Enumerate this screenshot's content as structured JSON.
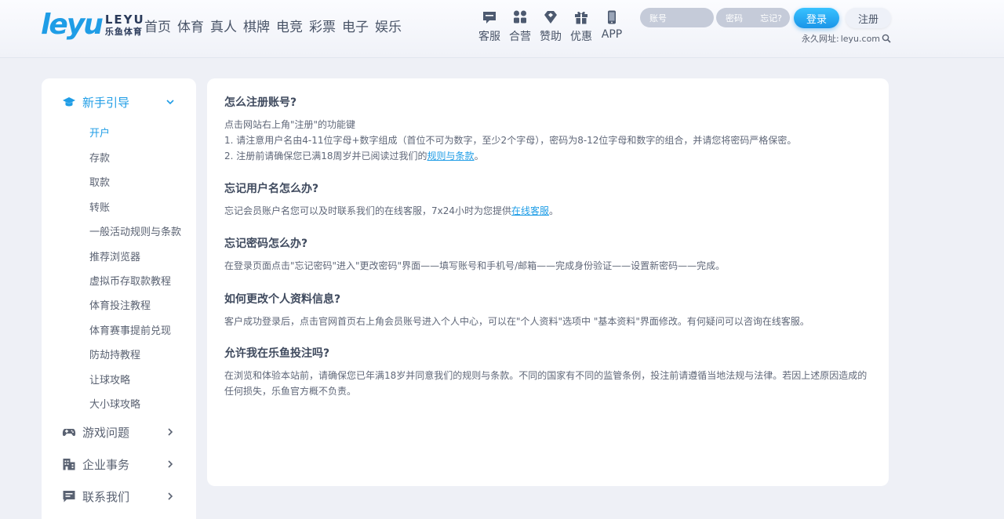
{
  "brand": {
    "logo_text": "leyu",
    "logo_en": "LEYU",
    "logo_cn": "乐鱼体育",
    "accent": "#1f9de6"
  },
  "nav": {
    "items": [
      "首页",
      "体育",
      "真人",
      "棋牌",
      "电竞",
      "彩票",
      "电子",
      "娱乐"
    ]
  },
  "tools": [
    {
      "label": "客服",
      "icon": "chat-icon"
    },
    {
      "label": "合营",
      "icon": "grid-icon"
    },
    {
      "label": "赞助",
      "icon": "diamond-icon"
    },
    {
      "label": "优惠",
      "icon": "gift-icon"
    },
    {
      "label": "APP",
      "icon": "phone-icon"
    }
  ],
  "auth": {
    "username_placeholder": "账号",
    "password_placeholder": "密码",
    "forgot_label": "忘记?",
    "login_label": "登录",
    "register_label": "注册",
    "permanent_label": "永久网址:",
    "permanent_url": "leyu.com"
  },
  "sidebar": {
    "categories": [
      {
        "label": "新手引导",
        "icon": "graduation-cap-icon",
        "expanded": true
      },
      {
        "label": "游戏问题",
        "icon": "gamepad-icon",
        "expanded": false
      },
      {
        "label": "企业事务",
        "icon": "building-icon",
        "expanded": false
      },
      {
        "label": "联系我们",
        "icon": "message-icon",
        "expanded": false
      }
    ],
    "guide_items": [
      "开户",
      "存款",
      "取款",
      "转账",
      "一般活动规则与条款",
      "推荐浏览器",
      "虚拟币存取款教程",
      "体育投注教程",
      "体育赛事提前兑现",
      "防劫持教程",
      "让球攻略",
      "大小球攻略"
    ],
    "active_item": "开户"
  },
  "faq": [
    {
      "question": "怎么注册账号?",
      "lines": [
        {
          "text": "点击网站右上角\"注册\"的功能键"
        },
        {
          "text": "1. 请注意用户名由4-11位字母+数字组成（首位不可为数字，至少2个字母），密码为8-12位字母和数字的组合，并请您将密码严格保密。"
        },
        {
          "text": "2. 注册前请确保您已满18周岁并已阅读过我们的",
          "link": "规则与条款",
          "suffix": "。"
        }
      ]
    },
    {
      "question": "忘记用户名怎么办?",
      "lines": [
        {
          "text": "忘记会员账户名您可以及时联系我们的在线客服，7x24小时为您提供",
          "link": "在线客服",
          "suffix": "。"
        }
      ]
    },
    {
      "question": "忘记密码怎么办?",
      "lines": [
        {
          "text": "在登录页面点击\"忘记密码\"进入\"更改密码\"界面——填写账号和手机号/邮箱——完成身份验证——设置新密码——完成。"
        }
      ]
    },
    {
      "question": "如何更改个人资料信息?",
      "lines": [
        {
          "text": "客户成功登录后，点击官网首页右上角会员账号进入个人中心，可以在\"个人资料\"选项中 \"基本资料\"界面修改。有何疑问可以咨询在线客服。"
        }
      ]
    },
    {
      "question": "允许我在乐鱼投注吗?",
      "lines": [
        {
          "text": "在浏览和体验本站前，请确保您已年满18岁并同意我们的规则与条款。不同的国家有不同的监管条例，投注前请遵循当地法规与法律。若因上述原因造成的任何损失，乐鱼官方概不负责。"
        }
      ]
    }
  ]
}
